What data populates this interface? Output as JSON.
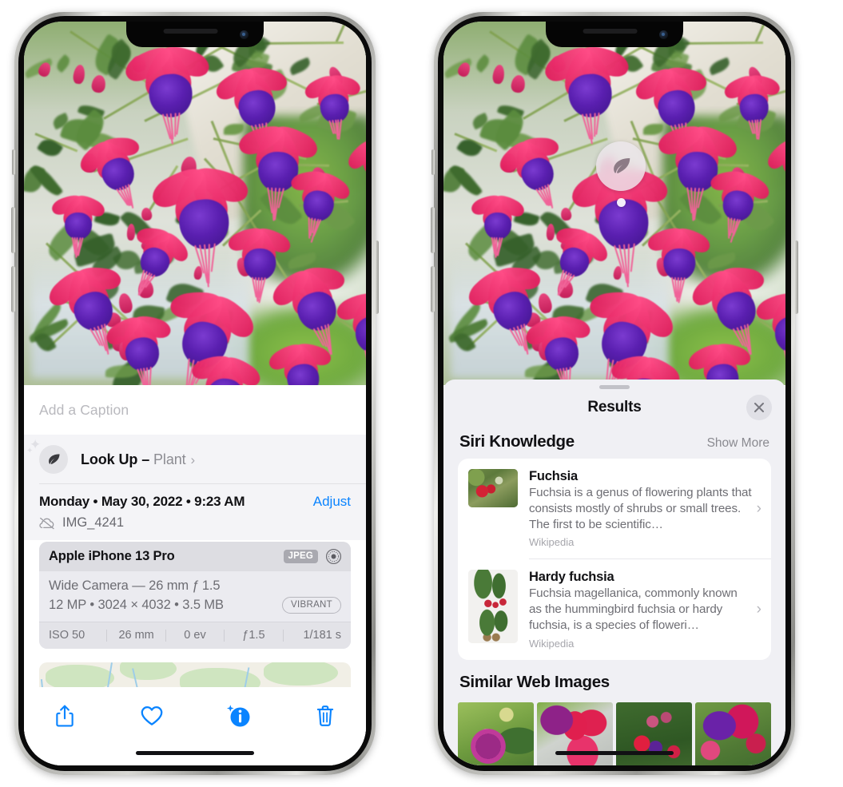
{
  "left_phone": {
    "caption_field": {
      "placeholder": "Add a Caption",
      "value": ""
    },
    "lookup_row": {
      "icon": "leaf-icon",
      "sparkle_icon": "sparkles-icon",
      "label": "Look Up –",
      "subject": "Plant",
      "chevron": "›"
    },
    "date_row": {
      "date_text": "Monday • May 30, 2022 • 9:23 AM",
      "adjust_label": "Adjust",
      "cloud_icon": "cloud-slash-icon",
      "file_name": "IMG_4241"
    },
    "exif": {
      "device": "Apple iPhone 13 Pro",
      "format_badge": "JPEG",
      "lens_icon": "camera-lens-icon",
      "lens_line": "Wide Camera — 26 mm ƒ 1.5",
      "size_line": "12 MP • 3024 × 4032 • 3.5 MB",
      "style_badge": "VIBRANT",
      "stats": [
        "ISO 50",
        "26 mm",
        "0 ev",
        "ƒ1.5",
        "1/181 s"
      ]
    },
    "map": {
      "pin": "photo-thumbnail-pin"
    },
    "toolbar": [
      {
        "name": "share-icon",
        "label": "Share"
      },
      {
        "name": "heart-icon",
        "label": "Favorite"
      },
      {
        "name": "info-sparkle-icon",
        "label": "Info"
      },
      {
        "name": "trash-icon",
        "label": "Delete"
      }
    ]
  },
  "right_phone": {
    "visual_lookup_badge": {
      "icon": "leaf-icon"
    },
    "sheet": {
      "grabber": "sheet-grabber",
      "title": "Results",
      "close_icon": "close-icon"
    },
    "siri_knowledge": {
      "title": "Siri Knowledge",
      "action": "Show More",
      "items": [
        {
          "title": "Fuchsia",
          "description": "Fuchsia is a genus of flowering plants that consists mostly of shrubs or small trees. The first to be scientific…",
          "source": "Wikipedia",
          "thumb": "fuchsia-red-flowers-thumb",
          "chevron": "›"
        },
        {
          "title": "Hardy fuchsia",
          "description": "Fuchsia magellanica, commonly known as the hummingbird fuchsia or hardy fuchsia, is a species of floweri…",
          "source": "Wikipedia",
          "thumb": "hardy-fuchsia-specimen-thumb",
          "chevron": "›"
        }
      ]
    },
    "similar_web_images": {
      "title": "Similar Web Images",
      "items": [
        {
          "name": "fuchsia-web-image-1"
        },
        {
          "name": "fuchsia-web-image-2"
        },
        {
          "name": "fuchsia-web-image-3"
        },
        {
          "name": "fuchsia-web-image-4"
        }
      ]
    }
  },
  "colors": {
    "accent_blue": "#0a84ff",
    "sheet_bg": "#f0f0f4",
    "card_bg": "#ffffff",
    "primary_text": "#111114",
    "secondary_text": "#6e6e74"
  }
}
